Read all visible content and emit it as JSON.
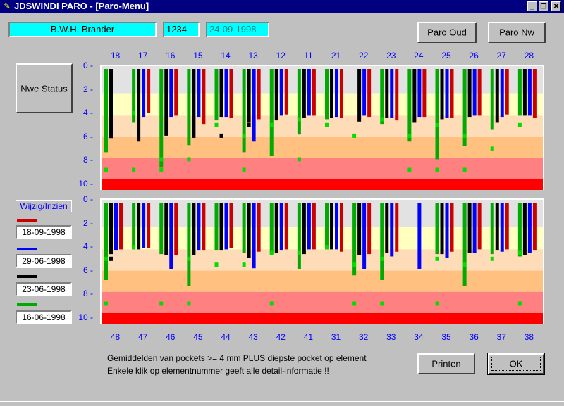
{
  "window": {
    "title": "JDSWINDI PARO - [Paro-Menu]",
    "app_icon": "paro-app-icon",
    "controls": [
      "_",
      "❐",
      "✕"
    ]
  },
  "patient": {
    "name": "B.W.H. Brander",
    "id": "1234",
    "date": "24-09-1998"
  },
  "buttons": {
    "paro_oud": "Paro Oud",
    "paro_nw": "Paro Nw",
    "nwe_status": "Nwe Status",
    "printen": "Printen",
    "ok": "OK"
  },
  "legend": {
    "title": "Wijzig/Inzien",
    "entries": [
      {
        "date": "18-09-1998",
        "color": "#cc0000"
      },
      {
        "date": "29-06-1998",
        "color": "#0000ff"
      },
      {
        "date": "23-06-1998",
        "color": "#000000"
      },
      {
        "date": "16-06-1998",
        "color": "#00aa00"
      }
    ]
  },
  "notes": {
    "line1": "Gemiddelden van pockets >= 4 mm PLUS diepste pocket op element",
    "line2": "Enkele klik op elementnummer geeft alle detail-informatie !!"
  },
  "chart_data": [
    {
      "type": "bar",
      "panel": "upper",
      "categories": [
        "18",
        "17",
        "16",
        "15",
        "14",
        "13",
        "12",
        "11",
        "21",
        "22",
        "23",
        "24",
        "25",
        "26",
        "27",
        "28"
      ],
      "ylim": [
        0,
        10.5
      ],
      "y_ticks": [
        "0",
        "2",
        "4",
        "6",
        "8",
        "10"
      ],
      "y_inverted": true,
      "bands": [
        {
          "from": 0,
          "to": 2.3,
          "color": "#e2e2e2"
        },
        {
          "from": 2.3,
          "to": 4.2,
          "color": "#ffffc0"
        },
        {
          "from": 4.2,
          "to": 6.0,
          "color": "#ffdcb8"
        },
        {
          "from": 6.0,
          "to": 7.8,
          "color": "#ffc080"
        },
        {
          "from": 7.8,
          "to": 9.6,
          "color": "#ff8080"
        },
        {
          "from": 9.6,
          "to": 10.5,
          "color": "#ff0000"
        }
      ],
      "series": [
        {
          "color": "#00aa00",
          "values": [
            7.3,
            4.8,
            8.6,
            6.7,
            4.6,
            7.3,
            7.6,
            5.8,
            4.5,
            0,
            4.9,
            6.4,
            7.9,
            6.8,
            5.4,
            4.2
          ],
          "markers": [
            [
              8.8
            ],
            [
              4.0,
              8.8
            ],
            [
              7.9,
              8.8
            ],
            [
              7.9
            ],
            [
              5.0
            ],
            [
              5.9,
              8.8
            ],
            [
              5.0
            ],
            [
              4.5,
              7.9
            ],
            [
              5.0
            ],
            [
              5.9
            ],
            [
              4.5
            ],
            [
              5.9,
              8.8
            ],
            [
              5.0,
              8.8
            ],
            [
              5.9,
              8.8
            ],
            [
              7.0
            ],
            [
              5.0
            ]
          ]
        },
        {
          "color": "#000000",
          "values": [
            6.1,
            6.4,
            5.9,
            5.8,
            4.3,
            4.8,
            4.6,
            4.4,
            4.4,
            4.7,
            4.4,
            4.8,
            4.5,
            4.3,
            4.8,
            4.2
          ],
          "markers": [
            [],
            [],
            [],
            [
              5.9
            ],
            [
              5.9
            ],
            [
              5.0
            ],
            [],
            [],
            [],
            [],
            [],
            [],
            [],
            [],
            [],
            []
          ]
        },
        {
          "color": "#0000ff",
          "values": [
            0,
            4.3,
            4.3,
            4.3,
            4.3,
            6.4,
            4.2,
            4.2,
            4.3,
            4.2,
            4.4,
            4.3,
            4.4,
            4.2,
            4.3,
            4.2
          ],
          "markers": [
            [],
            [],
            [],
            [],
            [],
            [],
            [],
            [],
            [],
            [],
            [],
            [],
            [],
            [],
            [],
            []
          ]
        },
        {
          "color": "#cc0000",
          "values": [
            0,
            4.0,
            4.2,
            4.9,
            4.4,
            4.5,
            4.1,
            4.2,
            4.4,
            4.3,
            4.6,
            4.3,
            4.4,
            4.2,
            4.1,
            4.4
          ],
          "markers": [
            [],
            [],
            [],
            [],
            [],
            [],
            [],
            [],
            [],
            [],
            [],
            [],
            [],
            [],
            [],
            []
          ]
        }
      ]
    },
    {
      "type": "bar",
      "panel": "lower",
      "categories": [
        "48",
        "47",
        "46",
        "45",
        "44",
        "43",
        "42",
        "41",
        "31",
        "32",
        "33",
        "34",
        "35",
        "36",
        "37",
        "38"
      ],
      "ylim": [
        0,
        10.5
      ],
      "y_ticks": [
        "0",
        "2",
        "4",
        "6",
        "8",
        "10"
      ],
      "y_inverted": true,
      "bands": [
        {
          "from": 0,
          "to": 2.3,
          "color": "#e2e2e2"
        },
        {
          "from": 2.3,
          "to": 4.2,
          "color": "#ffffc0"
        },
        {
          "from": 4.2,
          "to": 6.0,
          "color": "#ffdcb8"
        },
        {
          "from": 6.0,
          "to": 7.8,
          "color": "#ffc080"
        },
        {
          "from": 7.8,
          "to": 9.6,
          "color": "#ff8080"
        },
        {
          "from": 9.6,
          "to": 10.5,
          "color": "#ff0000"
        }
      ],
      "series": [
        {
          "color": "#00aa00",
          "values": [
            6.8,
            4.2,
            4.6,
            7.3,
            4.3,
            4.5,
            4.6,
            5.9,
            4.2,
            6.4,
            6.8,
            0,
            4.6,
            7.3,
            4.6,
            4.8
          ],
          "markers": [
            [
              5.0,
              8.8
            ],
            [
              4.0
            ],
            [
              8.8
            ],
            [
              5.0,
              8.8
            ],
            [
              5.5
            ],
            [
              5.5
            ],
            [
              4.5,
              8.8
            ],
            [
              4.5
            ],
            [
              4.0
            ],
            [
              5.5,
              8.8
            ],
            [
              5.0,
              8.8
            ],
            [],
            [
              5.0,
              8.8
            ],
            [
              5.5
            ],
            [
              5.0
            ],
            [
              4.5,
              8.8
            ]
          ]
        },
        {
          "color": "#000000",
          "values": [
            4.6,
            4.2,
            4.7,
            4.7,
            4.3,
            4.9,
            4.5,
            4.6,
            4.2,
            4.7,
            4.5,
            0,
            4.6,
            4.5,
            4.3,
            4.7
          ],
          "markers": [
            [
              5.0
            ],
            [],
            [],
            [],
            [],
            [],
            [],
            [],
            [],
            [],
            [],
            [],
            [],
            [],
            [],
            []
          ]
        },
        {
          "color": "#0000ff",
          "values": [
            4.3,
            4.1,
            5.9,
            4.3,
            4.2,
            5.8,
            4.3,
            4.2,
            4.2,
            5.9,
            4.8,
            5.9,
            4.9,
            4.5,
            4.4,
            4.5
          ],
          "markers": [
            [],
            [],
            [],
            [],
            [],
            [],
            [],
            [],
            [],
            [],
            [],
            [],
            [],
            [],
            [],
            []
          ]
        },
        {
          "color": "#cc0000",
          "values": [
            4.2,
            4.1,
            4.7,
            4.3,
            4.1,
            4.4,
            4.2,
            4.2,
            4.4,
            4.6,
            4.4,
            0,
            4.4,
            4.2,
            4.2,
            4.3
          ],
          "markers": [
            [],
            [],
            [],
            [],
            [],
            [],
            [],
            [],
            [],
            [],
            [],
            [],
            [],
            [],
            [],
            []
          ]
        }
      ]
    }
  ]
}
